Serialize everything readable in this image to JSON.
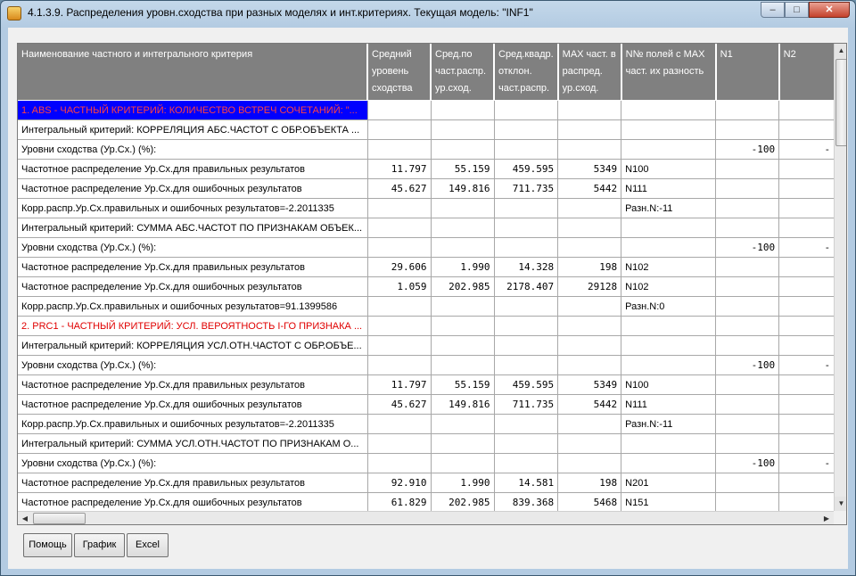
{
  "window": {
    "title": "4.1.3.9. Распределения уровн.сходства при разных моделях и инт.критериях. Текущая модель: \"INF1\"",
    "minimize": "–",
    "maximize": "□",
    "close": "✕"
  },
  "columns": [
    "Наименование частного и интегрального критерия",
    "Средний уровень сходства",
    "Сред.по част.распр. ур.сход.",
    "Сред.квадр. отклон. част.распр.",
    "MAX част. в распред. ур.сход.",
    "N№ полей с MAX част. их разность",
    "N1",
    "N2"
  ],
  "rows": [
    {
      "style": "hl",
      "cells": [
        "1. ABS - ЧАСТНЫЙ КРИТЕРИЙ: КОЛИЧЕСТВО ВСТРЕЧ СОЧЕТАНИЙ: \"...",
        "",
        "",
        "",
        "",
        "",
        "",
        ""
      ]
    },
    {
      "cells": [
        "Интегральный критерий: КОРРЕЛЯЦИЯ АБС.ЧАСТОТ С ОБР.ОБЪЕКТА   ...",
        "",
        "",
        "",
        "",
        "",
        "",
        ""
      ]
    },
    {
      "cells": [
        "Уровни сходства (Ур.Сх.) (%):",
        "",
        "",
        "",
        "",
        "",
        "-100",
        "-"
      ]
    },
    {
      "cells": [
        "Частотное распределение Ур.Сх.для правильных результатов",
        "11.797",
        "55.159",
        "459.595",
        "5349",
        "N100",
        "",
        ""
      ]
    },
    {
      "cells": [
        "Частотное распределение Ур.Сх.для ошибочных результатов",
        "45.627",
        "149.816",
        "711.735",
        "5442",
        "N111",
        "",
        ""
      ]
    },
    {
      "cells": [
        "Корр.распр.Ур.Сх.правильных и ошибочных результатов=-2.2011335",
        "",
        "",
        "",
        "",
        "Разн.N:-11",
        "",
        ""
      ]
    },
    {
      "cells": [
        "Интегральный критерий: СУММА АБС.ЧАСТОТ ПО ПРИЗНАКАМ ОБЪЕК...",
        "",
        "",
        "",
        "",
        "",
        "",
        ""
      ]
    },
    {
      "cells": [
        "Уровни сходства (Ур.Сх.) (%):",
        "",
        "",
        "",
        "",
        "",
        "-100",
        "-"
      ]
    },
    {
      "cells": [
        "Частотное распределение Ур.Сх.для правильных результатов",
        "29.606",
        "1.990",
        "14.328",
        "198",
        "N102",
        "",
        ""
      ]
    },
    {
      "cells": [
        "Частотное распределение Ур.Сх.для ошибочных результатов",
        "1.059",
        "202.985",
        "2178.407",
        "29128",
        "N102",
        "",
        ""
      ]
    },
    {
      "cells": [
        "Корр.распр.Ур.Сх.правильных и ошибочных результатов=91.1399586",
        "",
        "",
        "",
        "",
        "Разн.N:0",
        "",
        ""
      ]
    },
    {
      "style": "red",
      "cells": [
        "2. PRC1 - ЧАСТНЫЙ КРИТЕРИЙ: УСЛ. ВЕРОЯТНОСТЬ I-ГО ПРИЗНАКА ...",
        "",
        "",
        "",
        "",
        "",
        "",
        ""
      ]
    },
    {
      "cells": [
        "Интегральный критерий: КОРРЕЛЯЦИЯ УСЛ.ОТН.ЧАСТОТ С ОБР.ОБЪЕ...",
        "",
        "",
        "",
        "",
        "",
        "",
        ""
      ]
    },
    {
      "cells": [
        "Уровни сходства (Ур.Сх.) (%):",
        "",
        "",
        "",
        "",
        "",
        "-100",
        "-"
      ]
    },
    {
      "cells": [
        "Частотное распределение Ур.Сх.для правильных результатов",
        "11.797",
        "55.159",
        "459.595",
        "5349",
        "N100",
        "",
        ""
      ]
    },
    {
      "cells": [
        "Частотное распределение Ур.Сх.для ошибочных результатов",
        "45.627",
        "149.816",
        "711.735",
        "5442",
        "N111",
        "",
        ""
      ]
    },
    {
      "cells": [
        "Корр.распр.Ур.Сх.правильных и ошибочных результатов=-2.2011335",
        "",
        "",
        "",
        "",
        "Разн.N:-11",
        "",
        ""
      ]
    },
    {
      "cells": [
        "Интегральный критерий: СУММА УСЛ.ОТН.ЧАСТОТ ПО ПРИЗНАКАМ О...",
        "",
        "",
        "",
        "",
        "",
        "",
        ""
      ]
    },
    {
      "cells": [
        "Уровни сходства (Ур.Сх.) (%):",
        "",
        "",
        "",
        "",
        "",
        "-100",
        "-"
      ]
    },
    {
      "cells": [
        "Частотное распределение Ур.Сх.для правильных результатов",
        "92.910",
        "1.990",
        "14.581",
        "198",
        "N201",
        "",
        ""
      ]
    },
    {
      "cells": [
        "Частотное распределение Ур.Сх.для ошибочных результатов",
        "61.829",
        "202.985",
        "839.368",
        "5468",
        "N151",
        "",
        ""
      ]
    }
  ],
  "buttons": {
    "help": "Помощь",
    "chart": "График",
    "excel": "Excel"
  },
  "scroll_arrows": {
    "up": "▲",
    "down": "▼",
    "left": "◀",
    "right": "▶"
  }
}
